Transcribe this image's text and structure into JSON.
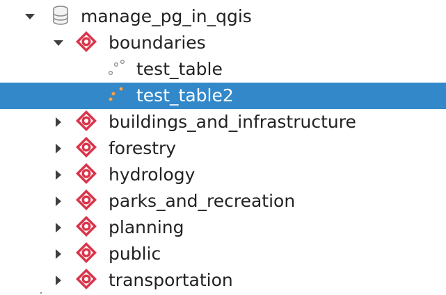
{
  "tree": {
    "database": {
      "label": "manage_pg_in_qgis",
      "icon": "database-icon",
      "expanded": true
    },
    "schemas": [
      {
        "label": "boundaries",
        "icon": "schema-icon",
        "expanded": true,
        "tables": [
          {
            "label": "test_table",
            "icon": "point-layer-icon",
            "selected": false
          },
          {
            "label": "test_table2",
            "icon": "point-layer-icon",
            "selected": true
          }
        ]
      },
      {
        "label": "buildings_and_infrastructure",
        "icon": "schema-icon",
        "expanded": false
      },
      {
        "label": "forestry",
        "icon": "schema-icon",
        "expanded": false
      },
      {
        "label": "hydrology",
        "icon": "schema-icon",
        "expanded": false
      },
      {
        "label": "parks_and_recreation",
        "icon": "schema-icon",
        "expanded": false
      },
      {
        "label": "planning",
        "icon": "schema-icon",
        "expanded": false
      },
      {
        "label": "public",
        "icon": "schema-icon",
        "expanded": false
      },
      {
        "label": "transportation",
        "icon": "schema-icon",
        "expanded": false
      }
    ]
  },
  "colors": {
    "selection": "#3288c9",
    "schema_icon": "#d9344a",
    "text": "#222222"
  }
}
